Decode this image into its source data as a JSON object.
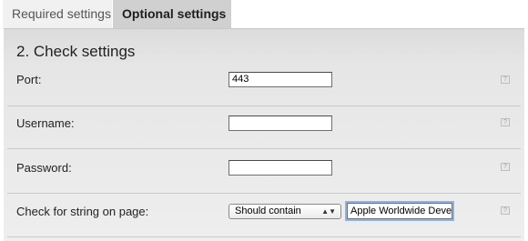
{
  "tabs": [
    {
      "label": "Required settings",
      "active": false
    },
    {
      "label": "Optional settings",
      "active": true
    }
  ],
  "section": {
    "title": "2. Check settings"
  },
  "fields": {
    "port": {
      "label": "Port:",
      "value": "443"
    },
    "username": {
      "label": "Username:",
      "value": ""
    },
    "password": {
      "label": "Password:",
      "value": ""
    },
    "check_string": {
      "label": "Check for string on page:",
      "select_value": "Should contain",
      "text_value": "Apple Worldwide Deve"
    }
  },
  "icons": {
    "help": "help-icon",
    "select_arrows": "up-down-arrows-icon"
  },
  "colors": {
    "active_tab_bg": "#d0d0d0",
    "inactive_tab_bg": "#f1f1f1",
    "panel_bg": "#e6e6e6",
    "focus_ring": "#8fb3e6"
  }
}
